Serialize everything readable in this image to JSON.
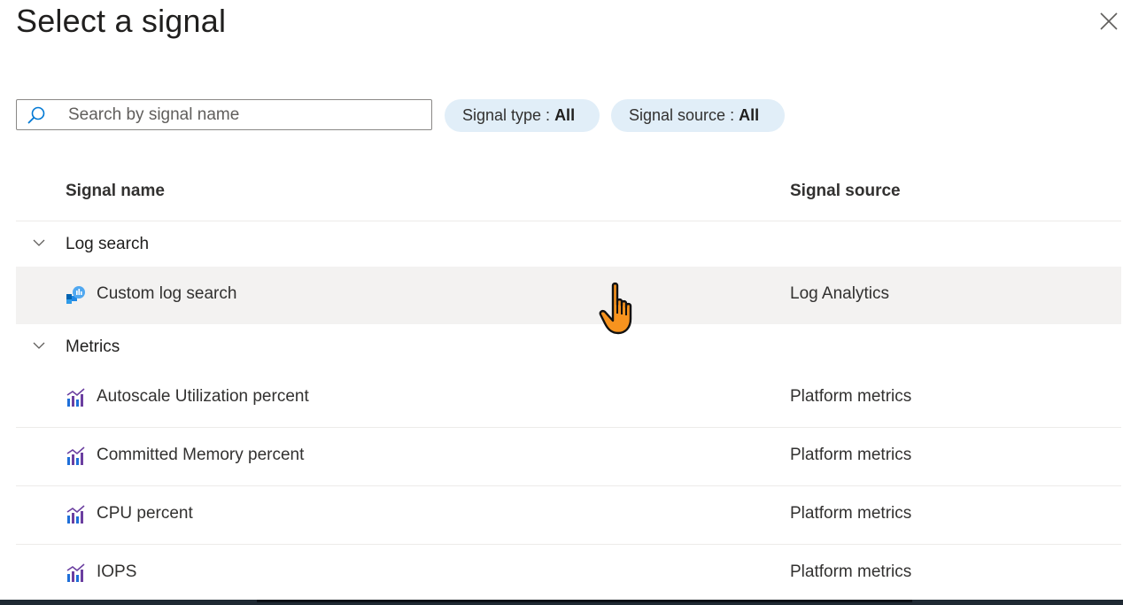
{
  "dialog": {
    "title": "Select a signal"
  },
  "search": {
    "placeholder": "Search by signal name",
    "value": ""
  },
  "filters": {
    "signal_type_label": "Signal type : ",
    "signal_type_value": "All",
    "signal_source_label": "Signal source : ",
    "signal_source_value": "All"
  },
  "table": {
    "col_name": "Signal name",
    "col_source": "Signal source",
    "groups": [
      {
        "label": "Log search",
        "rows": [
          {
            "name": "Custom log search",
            "source": "Log Analytics",
            "icon": "log-analytics-icon"
          }
        ]
      },
      {
        "label": "Metrics",
        "rows": [
          {
            "name": "Autoscale Utilization percent",
            "source": "Platform metrics",
            "icon": "metrics-icon"
          },
          {
            "name": "Committed Memory percent",
            "source": "Platform metrics",
            "icon": "metrics-icon"
          },
          {
            "name": "CPU percent",
            "source": "Platform metrics",
            "icon": "metrics-icon"
          },
          {
            "name": "IOPS",
            "source": "Platform metrics",
            "icon": "metrics-icon"
          }
        ]
      }
    ]
  },
  "colors": {
    "pill_bg": "#e1eef8",
    "hover_row": "#f3f2f1",
    "search_icon": "#0078d4",
    "metrics_purple": "#6b3fa0",
    "metrics_blue": "#1e6fd9",
    "cursor_orange": "#f7931e"
  }
}
